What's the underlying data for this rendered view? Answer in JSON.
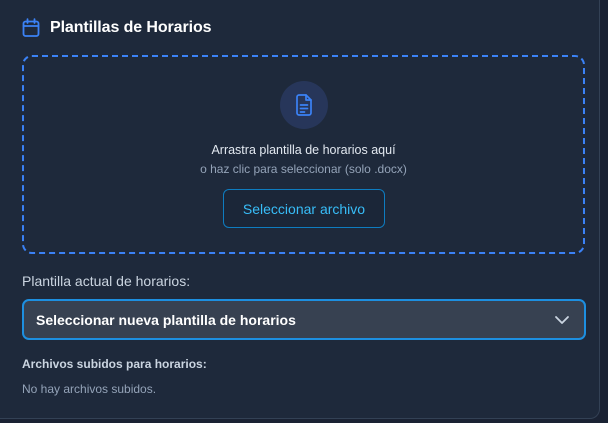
{
  "header": {
    "icon": "calendar-icon",
    "title": "Plantillas de Horarios"
  },
  "dropzone": {
    "icon": "document-icon",
    "main_text": "Arrastra plantilla de horarios aquí",
    "sub_text": "o haz clic para seleccionar (solo .docx)",
    "button_label": "Seleccionar archivo"
  },
  "current_template": {
    "label": "Plantilla actual de horarios:",
    "selected_value": "Seleccionar nueva plantilla de horarios",
    "icon": "chevron-down-icon"
  },
  "uploaded_files": {
    "label": "Archivos subidos para horarios:",
    "empty_text": "No hay archivos subidos."
  },
  "colors": {
    "accent": "#3b82f6",
    "background": "#1e293b",
    "button_text": "#38bdf8"
  }
}
